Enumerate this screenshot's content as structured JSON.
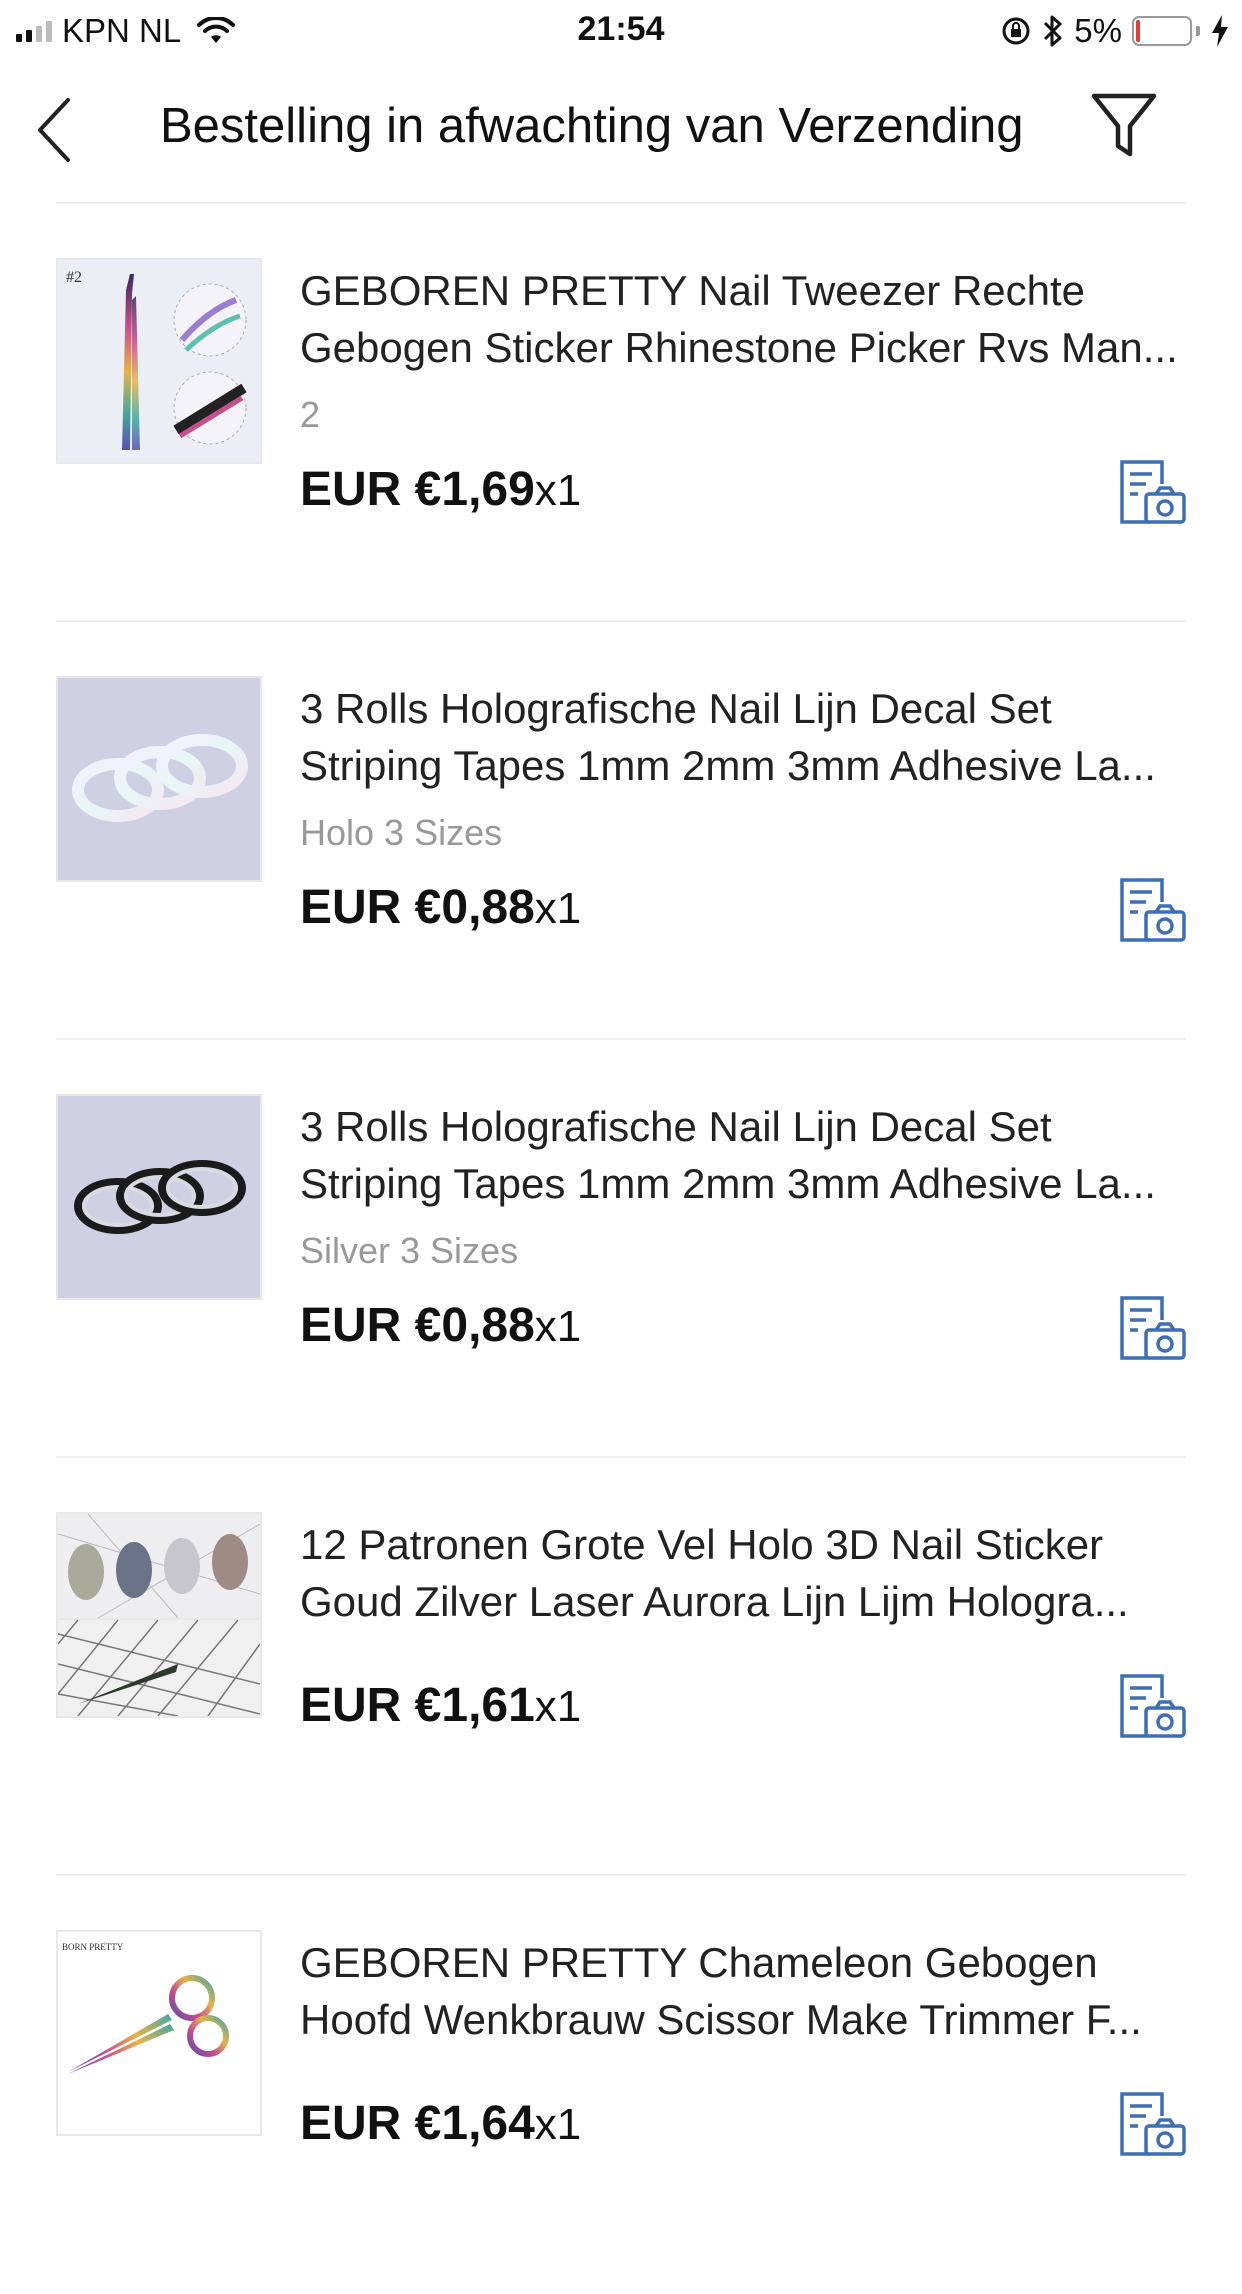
{
  "status_bar": {
    "carrier": "KPN NL",
    "time": "21:54",
    "battery_percent": "5%",
    "battery_level": 0.05,
    "battery_color": "#e53935",
    "icons": [
      "signal-icon",
      "wifi-icon",
      "orientation-lock-icon",
      "bluetooth-icon",
      "battery-icon",
      "charging-bolt-icon"
    ]
  },
  "header": {
    "title": "Bestelling in afwachting van Verzending",
    "back_icon": "chevron-left-icon",
    "filter_icon": "filter-funnel-icon"
  },
  "accent_color": "#3d6fb5",
  "orders": [
    {
      "title_line1": "GEBOREN PRETTY Nail Tweezer Rechte",
      "title_line2": "Gebogen Sticker Rhinestone Picker Rvs Man...",
      "variant": "2",
      "price": "EUR €1,69",
      "quantity": "x1",
      "image_label": "#2"
    },
    {
      "title_line1": "3 Rolls Holografische Nail Lijn Decal Set",
      "title_line2": "Striping Tapes 1mm 2mm 3mm Adhesive La...",
      "variant": "Holo 3 Sizes",
      "price": "EUR €0,88",
      "quantity": "x1"
    },
    {
      "title_line1": "3 Rolls Holografische Nail Lijn Decal Set",
      "title_line2": "Striping Tapes 1mm 2mm 3mm Adhesive La...",
      "variant": "Silver 3 Sizes",
      "price": "EUR €0,88",
      "quantity": "x1"
    },
    {
      "title_line1": "12 Patronen Grote Vel Holo 3D Nail Sticker",
      "title_line2": "Goud Zilver Laser Aurora Lijn Lijm Hologra...",
      "variant": "",
      "price": "EUR €1,61",
      "quantity": "x1"
    },
    {
      "title_line1": "GEBOREN PRETTY Chameleon Gebogen",
      "title_line2": "Hoofd Wenkbrauw Scissor Make Trimmer F...",
      "variant": "",
      "price": "EUR €1,64",
      "quantity": "x1",
      "image_label": "BORN PRETTY"
    }
  ]
}
